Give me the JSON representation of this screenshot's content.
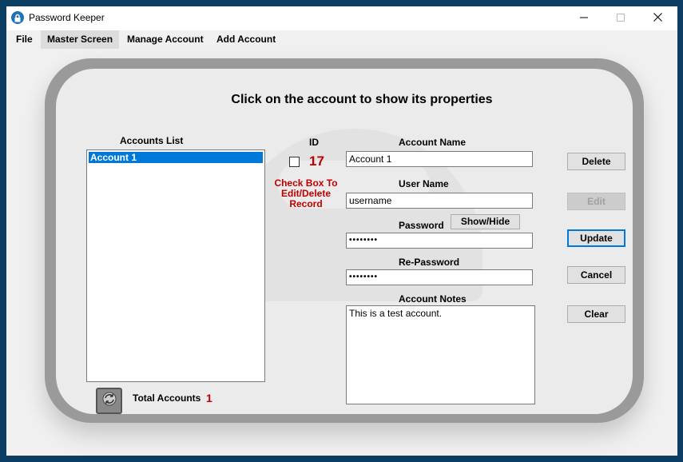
{
  "window": {
    "title": "Password Keeper",
    "controls": [
      "minimize-icon",
      "maximize-icon",
      "close-icon"
    ]
  },
  "menu": [
    {
      "label": "File"
    },
    {
      "label": "Master Screen"
    },
    {
      "label": "Manage Account"
    },
    {
      "label": "Add Account"
    }
  ],
  "main": {
    "heading": "Click on the account to show its properties",
    "accounts_list_label": "Accounts List",
    "accounts": [
      "Account 1"
    ],
    "id_label": "ID",
    "id_value": "17",
    "checkbox_hint_lines": [
      "Check Box To",
      "Edit/Delete",
      "Record"
    ],
    "account_name_label": "Account Name",
    "account_name_value": "Account 1",
    "user_name_label": "User Name",
    "user_name_value": "username",
    "password_label": "Password",
    "password_value": "••••••••",
    "show_hide_label": "Show/Hide",
    "repassword_label": "Re-Password",
    "repassword_value": "••••••••",
    "notes_label": "Account Notes",
    "notes_value": "This is a test account.",
    "total_label": "Total Accounts",
    "total_value": "1"
  },
  "buttons": {
    "delete": "Delete",
    "edit": "Edit",
    "update": "Update",
    "cancel": "Cancel",
    "clear": "Clear"
  },
  "colors": {
    "accent": "#0078d7",
    "red_text": "#c00000",
    "window_border": "#0b3c62"
  }
}
